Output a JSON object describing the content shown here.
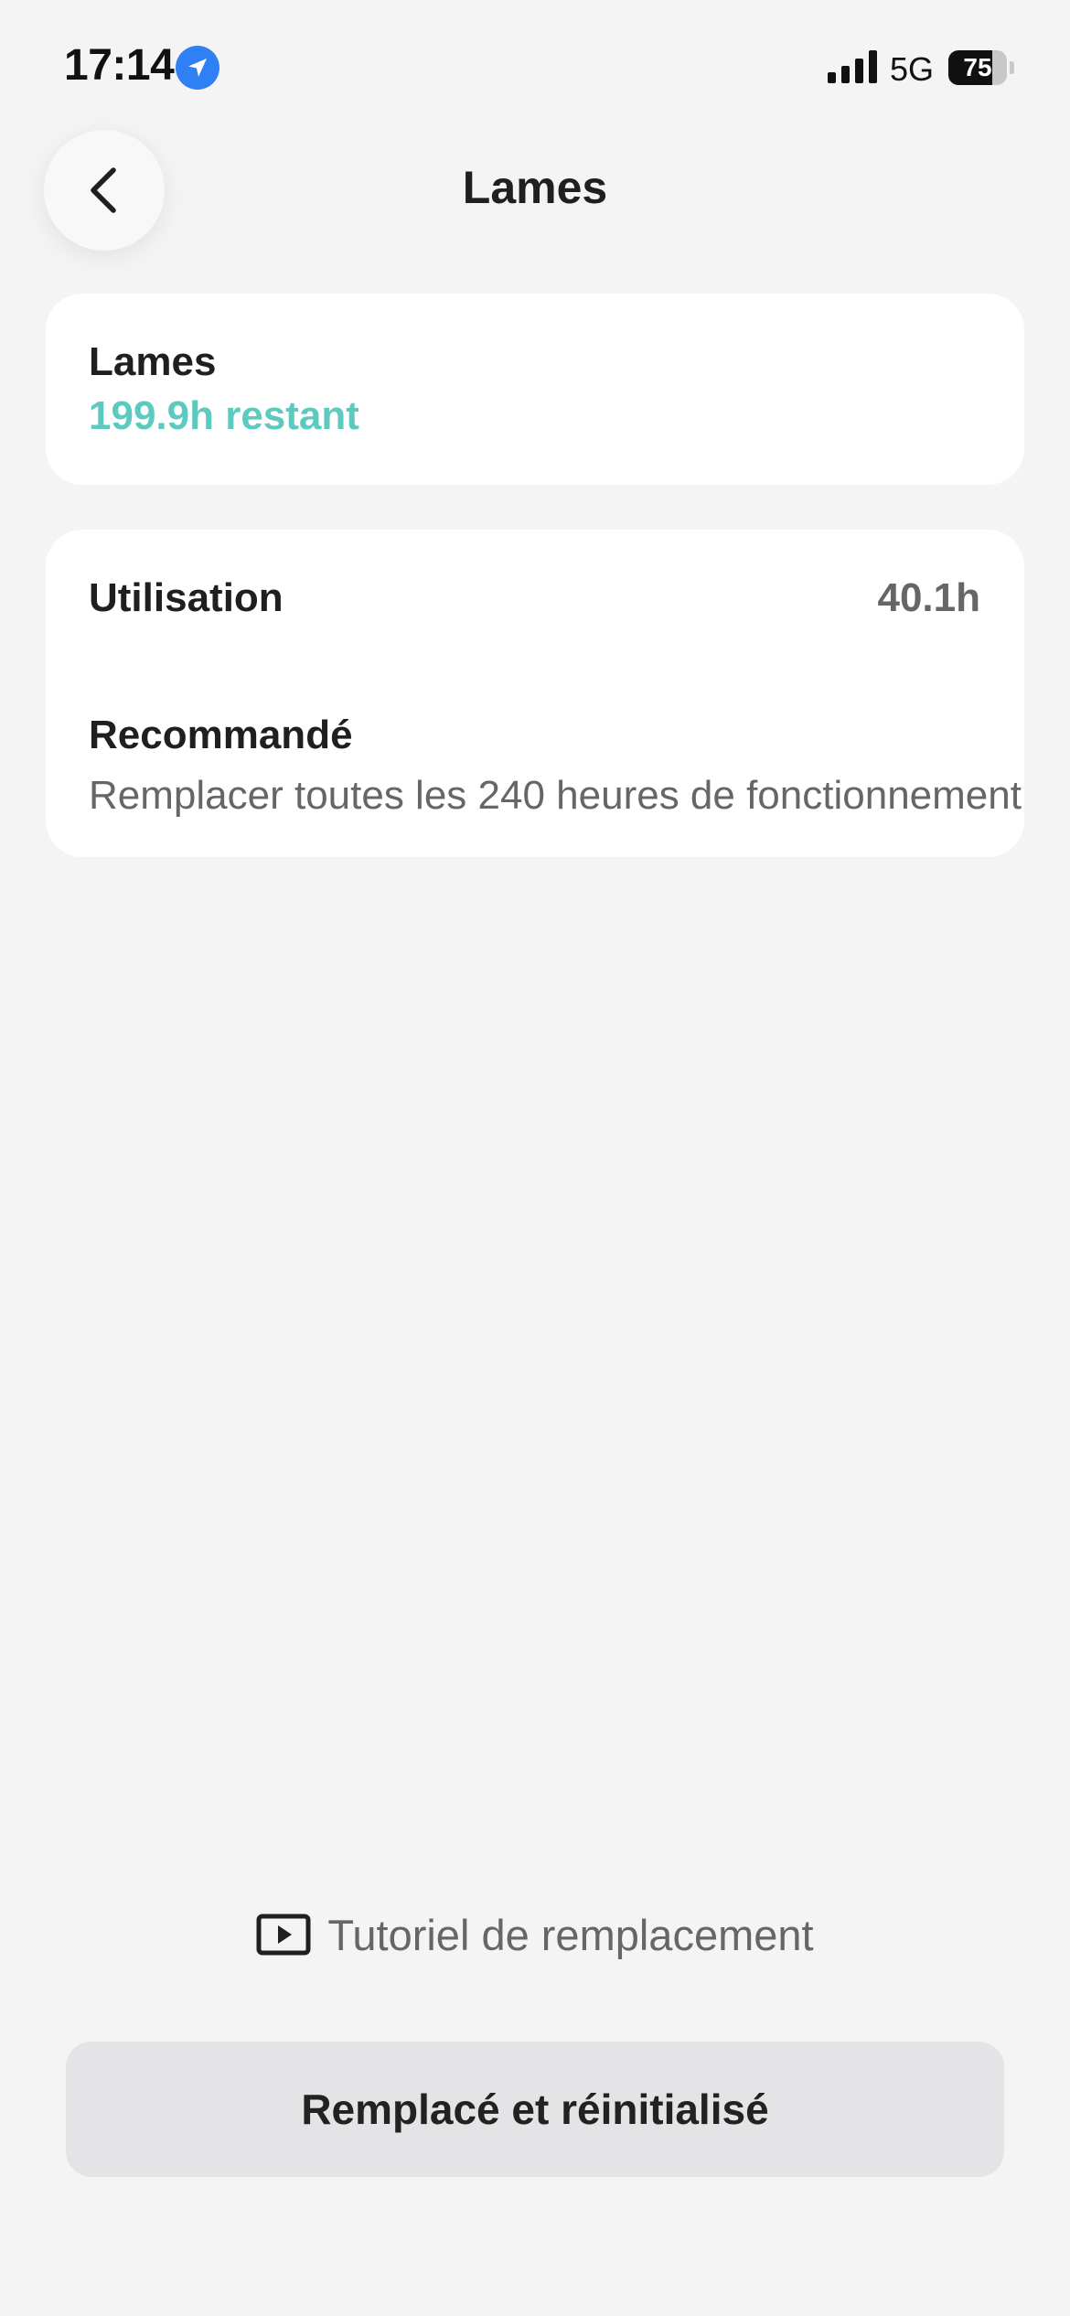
{
  "status_bar": {
    "time": "17:14",
    "network": "5G",
    "battery_percent": "75",
    "battery_level": 0.75,
    "location_icon": "location-arrow-icon",
    "signal_icon": "cellular-signal-icon"
  },
  "header": {
    "title": "Lames",
    "back_icon": "chevron-left-icon"
  },
  "blade_card": {
    "title": "Lames",
    "remaining": "199.9h restant",
    "accent_color": "#5ccabe"
  },
  "details_card": {
    "usage_label": "Utilisation",
    "usage_value": "40.1h",
    "recommended_label": "Recommandé",
    "recommended_text": "Remplacer toutes les 240 heures de fonctionnement"
  },
  "tutorial": {
    "label": "Tutoriel de remplacement",
    "icon": "play-video-icon"
  },
  "reset_button": {
    "label": "Remplacé et réinitialisé"
  }
}
